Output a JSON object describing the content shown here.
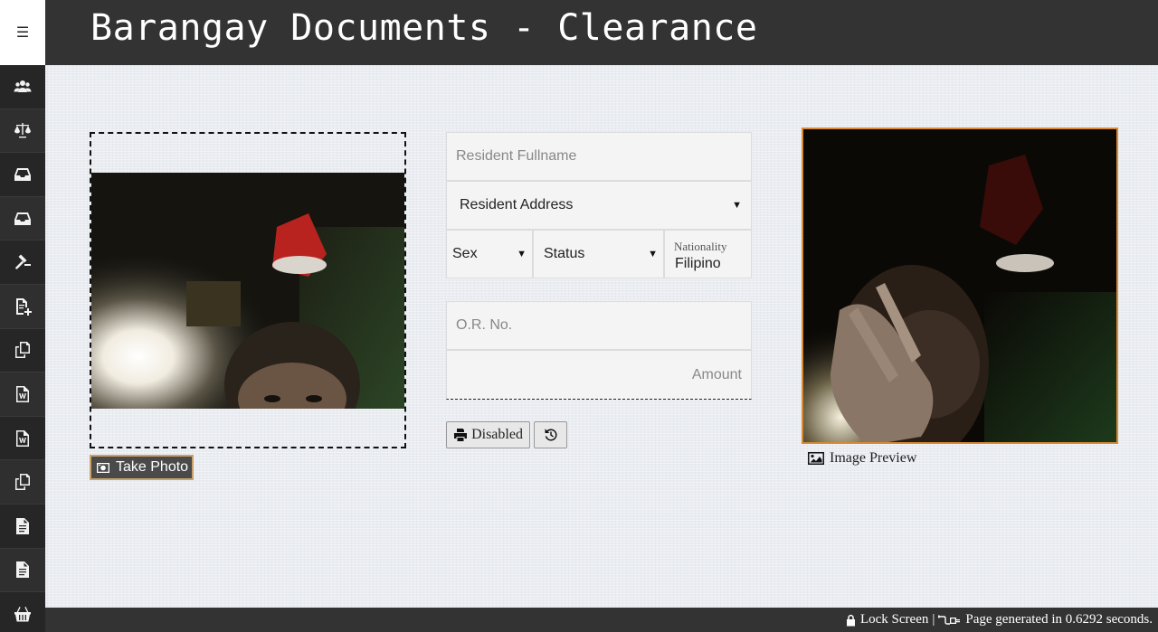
{
  "header": {
    "menu_glyph": "☰",
    "title": "Barangay Documents - Clearance"
  },
  "sidebar": {
    "items": [
      {
        "icon": "users-icon"
      },
      {
        "icon": "scale-icon"
      },
      {
        "icon": "inbox-icon"
      },
      {
        "icon": "inbox-icon"
      },
      {
        "icon": "gavel-icon"
      },
      {
        "icon": "file-add-icon"
      },
      {
        "icon": "copy-icon"
      },
      {
        "icon": "word-file-icon"
      },
      {
        "icon": "word-file-icon"
      },
      {
        "icon": "copy-icon"
      },
      {
        "icon": "file-text-icon"
      },
      {
        "icon": "file-text-icon"
      },
      {
        "icon": "basket-icon"
      }
    ]
  },
  "camera": {
    "take_photo_label": "Take Photo"
  },
  "form": {
    "fullname_placeholder": "Resident Fullname",
    "address_selected": "Resident Address",
    "sex_selected": "Sex",
    "status_selected": "Status",
    "nationality_label": "Nationality",
    "nationality_value": "Filipino",
    "or_no_placeholder": "O.R. No.",
    "amount_placeholder": "Amount"
  },
  "buttons": {
    "print_label": "Disabled"
  },
  "preview": {
    "caption": "Image Preview"
  },
  "footer": {
    "lock_label": "Lock Screen",
    "separator": "|",
    "generated_text": "Page generated in 0.6292 seconds."
  },
  "colors": {
    "header_bg": "#333333",
    "sidebar_bg": "#2b2b2b",
    "page_bg": "#e9ecf1",
    "preview_border": "#d98a32",
    "take_photo_border": "#c9a26a"
  }
}
